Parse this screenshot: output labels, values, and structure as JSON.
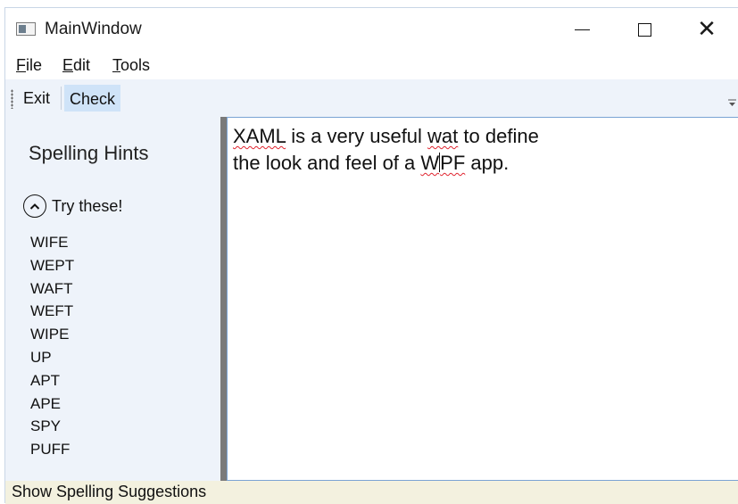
{
  "window": {
    "title": "MainWindow",
    "icon": "window-app-icon"
  },
  "menu": [
    "File",
    "Edit",
    "Tools"
  ],
  "toolbar": {
    "exit_label": "Exit",
    "check_label": "Check"
  },
  "sidebar": {
    "title": "Spelling Hints",
    "expander_label": "Try these!",
    "expanded": true,
    "suggestions": [
      "WIFE",
      "WEPT",
      "WAFT",
      "WEFT",
      "WIPE",
      "UP",
      "APT",
      "APE",
      "SPY",
      "PUFF"
    ]
  },
  "editor": {
    "line1": [
      "XAML",
      " is a very useful ",
      "wat",
      " to define"
    ],
    "line2": [
      "the look and feel of a ",
      "W",
      "PF",
      " app."
    ],
    "misspelled": [
      "XAML",
      "wat",
      "WPF"
    ]
  },
  "status": {
    "text": "Show Spelling Suggestions"
  },
  "colors": {
    "panel_bg": "#eef3fa",
    "toolbar_selected": "#cfe3f8",
    "status_bg": "#f3f1df",
    "squiggle": "#e0242f",
    "editor_border": "#7aa3d4"
  }
}
